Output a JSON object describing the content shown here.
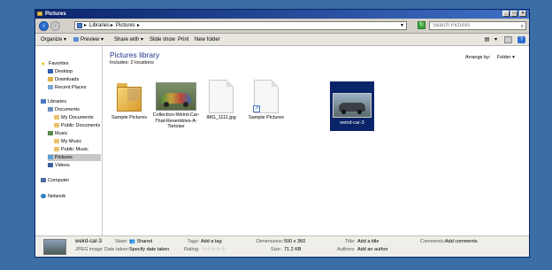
{
  "window": {
    "title": "Pictures"
  },
  "address": {
    "crumbs": [
      "Libraries",
      "Pictures"
    ],
    "separator": "▸",
    "search_placeholder": "Search Pictures"
  },
  "toolbar": {
    "organize": "Organize ▾",
    "preview": "Preview ▾",
    "share_with": "Share with ▾",
    "slide_show": "Slide show",
    "print": "Print",
    "new_folder": "New folder"
  },
  "nav": {
    "favorites": "Favorites",
    "desktop": "Desktop",
    "downloads": "Downloads",
    "recent_places": "Recent Places",
    "libraries": "Libraries",
    "documents": "Documents",
    "my_documents": "My Documents",
    "public_documents": "Public Documents",
    "music": "Music",
    "my_music": "My Music",
    "public_music": "Public Music",
    "pictures": "Pictures",
    "videos": "Videos",
    "computer": "Computer",
    "network": "Network"
  },
  "library": {
    "title": "Pictures library",
    "includes": "Includes:  2 locations",
    "arrange_by_label": "Arrange by:",
    "arrange_by_value": "Folder  ▾"
  },
  "items": [
    {
      "label": "Sample Pictures",
      "kind": "folder-icon"
    },
    {
      "label": "Collection-Weird-Car-That-Resembles-A-Tortoise",
      "kind": "image"
    },
    {
      "label": "IMG_1111.jpg",
      "kind": "blank-file-icon"
    },
    {
      "label": "Sample Pictures",
      "kind": "shortcut-icon"
    },
    {
      "label": "weird-car-3",
      "kind": "image",
      "selected": true
    }
  ],
  "details": {
    "name": "weird-car-3",
    "type": "JPEG image",
    "state_label": "State:",
    "state_value": "Shared",
    "date_label": "Date taken:",
    "date_value": "Specify date taken",
    "tags_label": "Tags:",
    "tags_value": "Add a tag",
    "rating_label": "Rating:",
    "rating_stars": "☆☆☆☆☆",
    "dimensions_label": "Dimensions:",
    "dimensions_value": "500 x 360",
    "size_label": "Size:",
    "size_value": "71.2 KB",
    "title_label": "Title:",
    "title_value": "Add a title",
    "authors_label": "Authors:",
    "authors_value": "Add an author",
    "comments_label": "Comments:",
    "comments_value": "Add comments"
  },
  "colors": {
    "desktop": "#3a6ea5",
    "titlebar": "#0a246a",
    "selection": "#0a246a",
    "library_title": "#1e3287"
  }
}
